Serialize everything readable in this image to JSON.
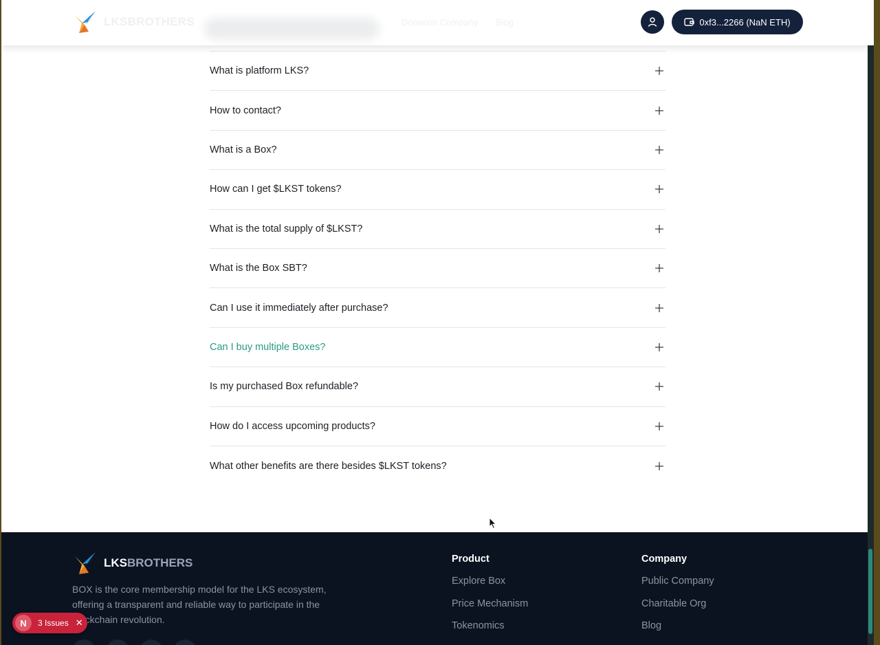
{
  "header": {
    "logo_lks": "LKS",
    "logo_brothers": "BROTHERS",
    "nav_ghost": [
      "Donation Company",
      "Blog"
    ],
    "wallet_label": "0xf3...2266 (NaN ETH)",
    "icons": {
      "user": "user-icon",
      "wallet": "wallet-icon"
    }
  },
  "faq": {
    "items": [
      {
        "question": "What is platform LKS?"
      },
      {
        "question": "How to contact?"
      },
      {
        "question": "What is a Box?"
      },
      {
        "question": "How can I get $LKST tokens?"
      },
      {
        "question": "What is the total supply of $LKST?"
      },
      {
        "question": "What is the Box SBT?"
      },
      {
        "question": "Can I use it immediately after purchase?"
      },
      {
        "question": "Can I buy multiple Boxes?"
      },
      {
        "question": "Is my purchased Box refundable?"
      },
      {
        "question": "How do I access upcoming products?"
      },
      {
        "question": "What other benefits are there besides $LKST tokens?"
      }
    ],
    "active_index": 7,
    "active_color": "#2a9a86",
    "expand_icon": "plus-icon"
  },
  "footer": {
    "logo_lks": "LKS",
    "logo_brothers": "BROTHERS",
    "description": "BOX is the core membership model for the LKS ecosystem, offering a transparent and reliable way to participate in the blockchain revolution.",
    "product": {
      "heading": "Product",
      "links": [
        "Explore Box",
        "Price Mechanism",
        "Tokenomics"
      ]
    },
    "company": {
      "heading": "Company",
      "links": [
        "Public Company",
        "Charitable Org",
        "Blog"
      ]
    }
  },
  "issues_badge": {
    "letter": "N",
    "label": "3 Issues",
    "close": "✕"
  },
  "colors": {
    "navy": "#13213b",
    "footer_bg": "#0b1320",
    "accent_teal": "#2a9a86",
    "issues_red": "#c8233a"
  }
}
